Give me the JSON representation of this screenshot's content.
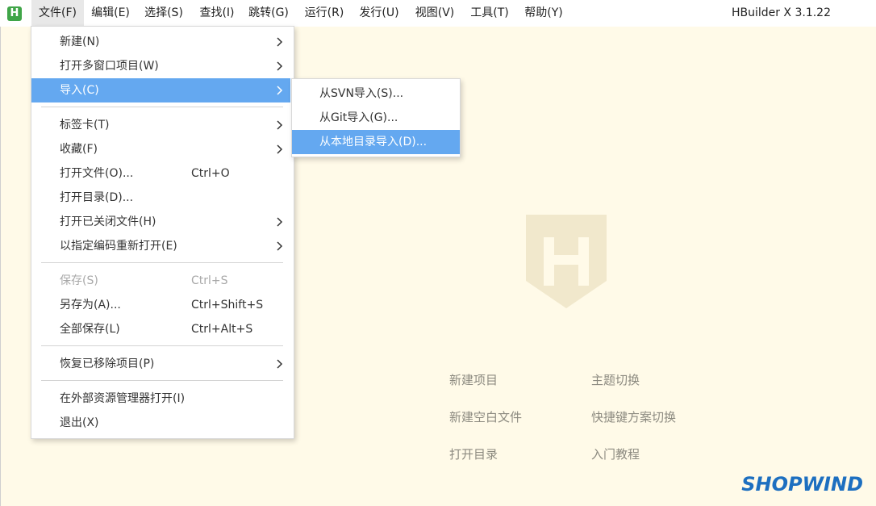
{
  "app": {
    "logo_letter": "H",
    "version": "HBuilder X 3.1.22"
  },
  "menubar": [
    "文件(F)",
    "编辑(E)",
    "选择(S)",
    "查找(I)",
    "跳转(G)",
    "运行(R)",
    "发行(U)",
    "视图(V)",
    "工具(T)",
    "帮助(Y)"
  ],
  "file_menu": {
    "new": "新建(N)",
    "open_multi": "打开多窗口项目(W)",
    "import": "导入(C)",
    "tabs": "标签卡(T)",
    "favorites": "收藏(F)",
    "open_file": "打开文件(O)...",
    "open_file_sc": "Ctrl+O",
    "open_dir": "打开目录(D)...",
    "open_closed": "打开已关闭文件(H)",
    "reopen_enc": "以指定编码重新打开(E)",
    "save": "保存(S)",
    "save_sc": "Ctrl+S",
    "save_as": "另存为(A)...",
    "save_as_sc": "Ctrl+Shift+S",
    "save_all": "全部保存(L)",
    "save_all_sc": "Ctrl+Alt+S",
    "restore": "恢复已移除项目(P)",
    "open_explorer": "在外部资源管理器打开(I)",
    "exit": "退出(X)"
  },
  "import_submenu": {
    "svn": "从SVN导入(S)...",
    "git": "从Git导入(G)...",
    "local": "从本地目录导入(D)..."
  },
  "quick_links": {
    "new_project": "新建项目",
    "theme": "主题切换",
    "new_blank": "新建空白文件",
    "keymap": "快捷键方案切换",
    "open_dir": "打开目录",
    "tutorial": "入门教程"
  },
  "watermark": "SHOPWIND",
  "colors": {
    "highlight": "#64a8f0",
    "logo_green": "#3fa548",
    "background": "#fffae8",
    "watermark": "#1d6fc0"
  }
}
